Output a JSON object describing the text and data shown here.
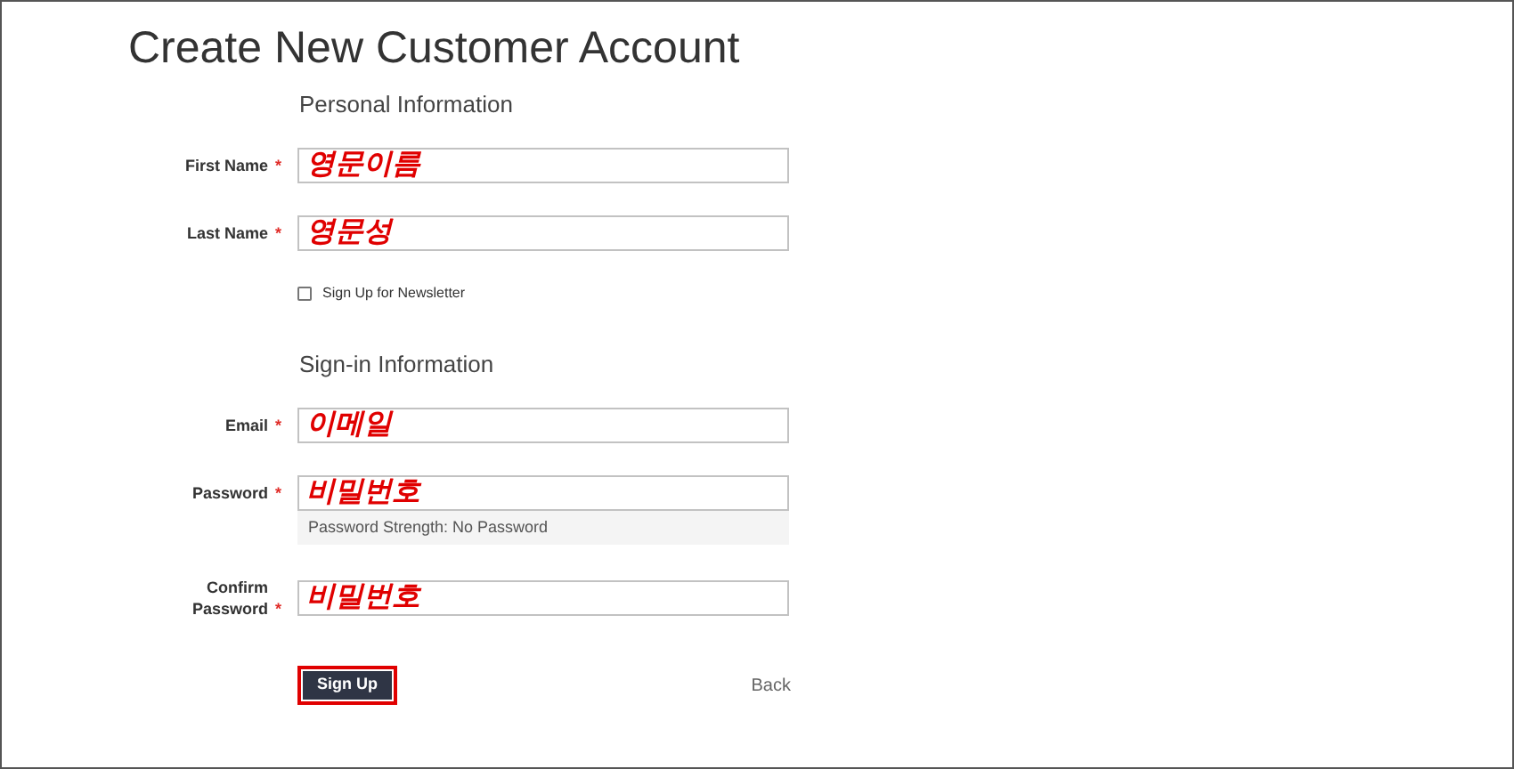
{
  "title": "Create New Customer Account",
  "sections": [
    {
      "heading": "Personal Information",
      "fields": [
        {
          "kind": "text",
          "label": "First Name",
          "required_mark": "*",
          "value": "영문이름"
        },
        {
          "kind": "text",
          "label": "Last Name",
          "required_mark": "*",
          "value": "영문성"
        },
        {
          "kind": "checkbox",
          "label": "Sign Up for Newsletter",
          "checked": false
        }
      ]
    },
    {
      "heading": "Sign-in Information",
      "fields": [
        {
          "kind": "text",
          "label": "Email",
          "required_mark": "*",
          "value": "이메일"
        },
        {
          "kind": "password",
          "label": "Password",
          "required_mark": "*",
          "value": "비밀번호",
          "strength": "Password Strength: No Password"
        },
        {
          "kind": "text",
          "label": "Confirm Password",
          "required_mark": "*",
          "value": "비밀번호"
        }
      ]
    }
  ],
  "submit": {
    "label": "Sign Up",
    "highlighted": true
  },
  "back_link": "Back"
}
